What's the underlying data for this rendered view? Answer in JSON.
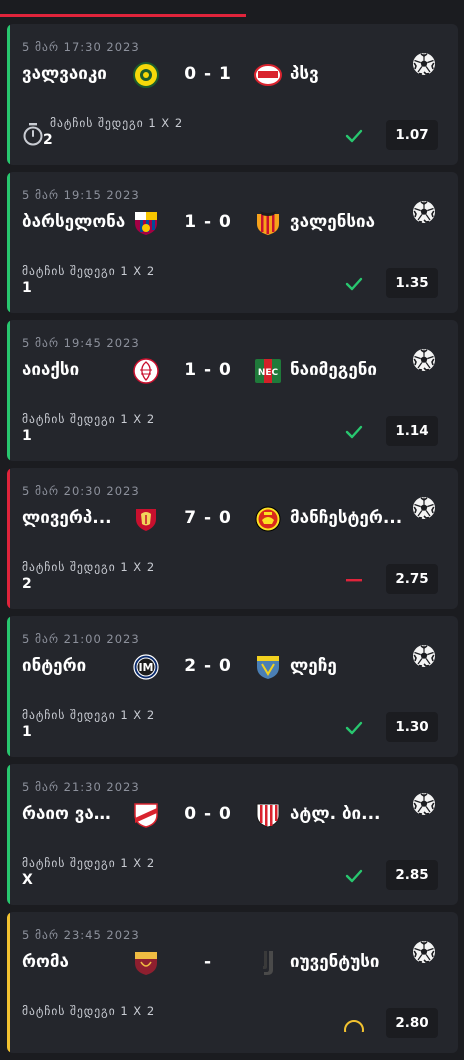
{
  "colors": {
    "won": "#28c76f",
    "lost": "#e0243b",
    "pending": "#f2c230",
    "background": "#1b1c20",
    "card": "#24262c",
    "progress": "#e0243b"
  },
  "progress_fraction": 0.53,
  "bets": [
    {
      "datetime": "5 მარ 17:30 2023",
      "home": "ვალვაიკი",
      "score": "0 - 1",
      "away": "პსვ",
      "market": "მატჩის შედეგი 1 X 2",
      "pick": "2",
      "odds": "1.07",
      "status": "won",
      "has_timer_icon": true,
      "home_logo": "rkc-waalwijk-logo",
      "away_logo": "psv-logo",
      "sport_icon": "soccer-ball-icon"
    },
    {
      "datetime": "5 მარ 19:15 2023",
      "home": "ბარსელონა",
      "score": "1 - 0",
      "away": "ვალენსია",
      "market": "მატჩის შედეგი 1 X 2",
      "pick": "1",
      "odds": "1.35",
      "status": "won",
      "has_timer_icon": false,
      "home_logo": "barcelona-logo",
      "away_logo": "valencia-logo",
      "sport_icon": "soccer-ball-icon"
    },
    {
      "datetime": "5 მარ 19:45 2023",
      "home": "აიაქსი",
      "score": "1 - 0",
      "away": "ნაიმეგენი",
      "market": "მატჩის შედეგი 1 X 2",
      "pick": "1",
      "odds": "1.14",
      "status": "won",
      "has_timer_icon": false,
      "home_logo": "ajax-logo",
      "away_logo": "nec-logo",
      "sport_icon": "soccer-ball-icon"
    },
    {
      "datetime": "5 მარ 20:30 2023",
      "home": "ლივერპ...",
      "score": "7 - 0",
      "away": "მანჩესტერ...",
      "market": "მატჩის შედეგი 1 X 2",
      "pick": "2",
      "odds": "2.75",
      "status": "lost",
      "has_timer_icon": false,
      "home_logo": "liverpool-logo",
      "away_logo": "manchester-united-logo",
      "sport_icon": "soccer-ball-icon"
    },
    {
      "datetime": "5 მარ 21:00 2023",
      "home": "ინტერი",
      "score": "2 - 0",
      "away": "ლეჩე",
      "market": "მატჩის შედეგი 1 X 2",
      "pick": "1",
      "odds": "1.30",
      "status": "won",
      "has_timer_icon": false,
      "home_logo": "inter-logo",
      "away_logo": "lecce-logo",
      "sport_icon": "soccer-ball-icon"
    },
    {
      "datetime": "5 მარ 21:30 2023",
      "home": "რაიო ვალ...",
      "score": "0 - 0",
      "away": "ატლ. ბი...",
      "market": "მატჩის შედეგი 1 X 2",
      "pick": "X",
      "odds": "2.85",
      "status": "won",
      "has_timer_icon": false,
      "home_logo": "rayo-vallecano-logo",
      "away_logo": "athletic-bilbao-logo",
      "sport_icon": "soccer-ball-icon"
    },
    {
      "datetime": "5 მარ 23:45 2023",
      "home": "რომა",
      "score": "-",
      "away": "იუვენტუსი",
      "market": "მატჩის შედეგი 1 X 2",
      "pick": "",
      "odds": "2.80",
      "status": "pending",
      "has_timer_icon": false,
      "home_logo": "roma-logo",
      "away_logo": "juventus-logo",
      "sport_icon": "soccer-ball-icon"
    }
  ]
}
